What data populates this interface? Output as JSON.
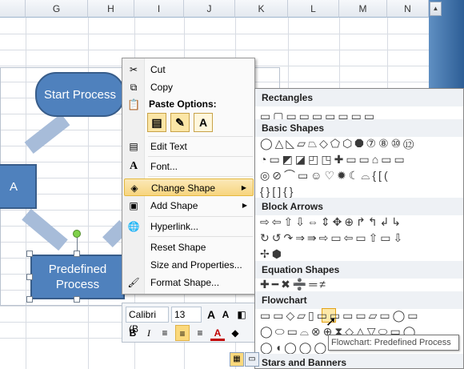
{
  "columns": [
    "G",
    "H",
    "I",
    "J",
    "K",
    "L",
    "M",
    "N"
  ],
  "shapes": {
    "start_process": "Start Process",
    "partial_a": "A",
    "predefined_line1": "Predefined",
    "predefined_line2": "Process"
  },
  "context_menu": {
    "cut": "Cut",
    "copy": "Copy",
    "paste_options": "Paste Options:",
    "edit_text": "Edit Text",
    "font": "Font...",
    "change_shape": "Change Shape",
    "add_shape": "Add Shape",
    "hyperlink": "Hyperlink...",
    "reset_shape": "Reset Shape",
    "size_properties": "Size and Properties...",
    "format_shape": "Format Shape..."
  },
  "mini_toolbar": {
    "font_name": "Calibri (B",
    "font_size": "13",
    "grow": "A",
    "shrink": "A",
    "bold": "B",
    "italic": "I",
    "font_color": "A"
  },
  "gallery": {
    "rectangles": "Rectangles",
    "basic_shapes": "Basic Shapes",
    "block_arrows": "Block Arrows",
    "equation_shapes": "Equation Shapes",
    "flowchart": "Flowchart",
    "stars_banners": "Stars and Banners",
    "rect_row": "▭▢▭▭▭▭▭▭▭",
    "basic_row1": "◯△◺▱⏢◇⬠⬡⯃⑦⑧⑩⑫",
    "basic_row2": "◔▭◩◪◰◳✚▭▭⌂▭▭",
    "basic_row3": "◎⊘⌒▭☺♡✹☾⌓{[(",
    "basic_row4": "{}[]{}",
    "arrow_row1": "⇨⇦⇧⇩⇔⇕✥⊕↱↰↲↳",
    "arrow_row2": "↻↺↷⇒⇛⇨▭⇦▭⇧▭⇩",
    "arrow_row3": "✢⬢",
    "equation_row": "✚━✖➗═≠",
    "flow_row1": "▭▭◇▱▯▭▭▭▭▱▭◯▭",
    "flow_row2": "◯⬭▭⌓⊗⊕⧗◇△▽⬭▭◯",
    "flow_row3": "◯◖◯◯◯"
  },
  "tooltip": "Flowchart: Predefined Process"
}
